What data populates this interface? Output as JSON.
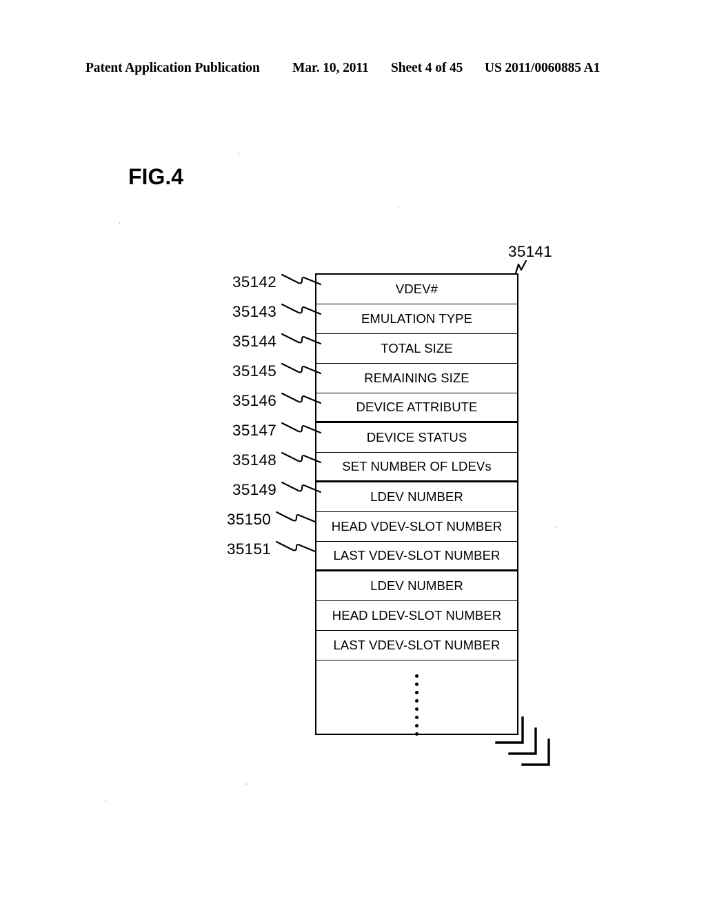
{
  "header": {
    "publication": "Patent Application Publication",
    "date": "Mar. 10, 2011",
    "sheet": "Sheet 4 of 45",
    "patent_number": "US 2011/0060885 A1"
  },
  "figure": {
    "title": "FIG.4",
    "main_reference": "35141"
  },
  "table": {
    "rows": [
      {
        "label": "VDEV#",
        "ref": "35142",
        "divider": "normal"
      },
      {
        "label": "EMULATION TYPE",
        "ref": "35143",
        "divider": "normal"
      },
      {
        "label": "TOTAL SIZE",
        "ref": "35144",
        "divider": "normal"
      },
      {
        "label": "REMAINING SIZE",
        "ref": "35145",
        "divider": "normal"
      },
      {
        "label": "DEVICE ATTRIBUTE",
        "ref": "35146",
        "divider": "thick"
      },
      {
        "label": "DEVICE STATUS",
        "ref": "35147",
        "divider": "normal"
      },
      {
        "label": "SET NUMBER OF LDEVs",
        "ref": "35148",
        "divider": "thick"
      },
      {
        "label": "LDEV NUMBER",
        "ref": "35149",
        "divider": "normal"
      },
      {
        "label": "HEAD VDEV-SLOT NUMBER",
        "ref": "35150",
        "divider": "normal"
      },
      {
        "label": "LAST VDEV-SLOT NUMBER",
        "ref": "35151",
        "divider": "thick"
      },
      {
        "label": "LDEV NUMBER",
        "ref": "",
        "divider": "normal"
      },
      {
        "label": "HEAD LDEV-SLOT NUMBER",
        "ref": "",
        "divider": "normal"
      },
      {
        "label": "LAST VDEV-SLOT NUMBER",
        "ref": "",
        "divider": "normal"
      }
    ],
    "ellipsis_dot_count": 8
  },
  "colors": {
    "ink": "#000000",
    "paper": "#ffffff"
  }
}
